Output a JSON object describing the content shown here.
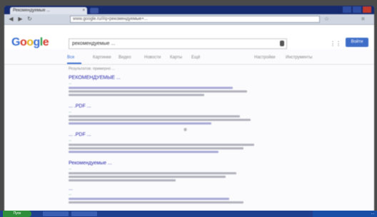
{
  "browser": {
    "tab_title": "Рекомендуемые ...",
    "tab_close": "×",
    "address": "www.google.ru/#q=рекомендуемые+...",
    "back_icon": "back-arrow-icon",
    "forward_icon": "forward-arrow-icon",
    "reload_icon": "reload-icon",
    "star_icon": "star-icon",
    "wrench_icon": "wrench-icon"
  },
  "google": {
    "logo": [
      "G",
      "o",
      "o",
      "g",
      "l",
      "e"
    ],
    "query": "рекомендуемые ...",
    "sign_in": "Войти",
    "apps_icon": "⋮⋮"
  },
  "search_tabs": [
    {
      "label": "Все",
      "active": true
    },
    {
      "label": "Картинки",
      "active": false
    },
    {
      "label": "Видео",
      "active": false
    },
    {
      "label": "Новости",
      "active": false
    },
    {
      "label": "Карты",
      "active": false
    },
    {
      "label": "Ещё",
      "active": false
    },
    {
      "label": "Настройки",
      "active": false
    },
    {
      "label": "Инструменты",
      "active": false
    }
  ],
  "stats_text": "Результатов: примерно ...",
  "results": [
    {
      "title": "РЕКОМЕНДУЕМЫЕ ...",
      "url": "...",
      "lines": 3
    },
    {
      "title": "... .PDF ...",
      "url": "...",
      "lines": 3
    },
    {
      "title": "... .PDF ...",
      "url": "...",
      "lines": 3
    },
    {
      "title": "Рекомендуемые ...",
      "url": "...",
      "lines": 3
    },
    {
      "title": "... ",
      "url": "...",
      "lines": 2
    }
  ],
  "taskbar": {
    "start_label": "Пуск",
    "clock": "..."
  },
  "colors": {
    "link": "#2a2aaa",
    "url": "#2c8f3b",
    "accent": "#3b6fd1",
    "taskbar": "#1f3f8f"
  }
}
